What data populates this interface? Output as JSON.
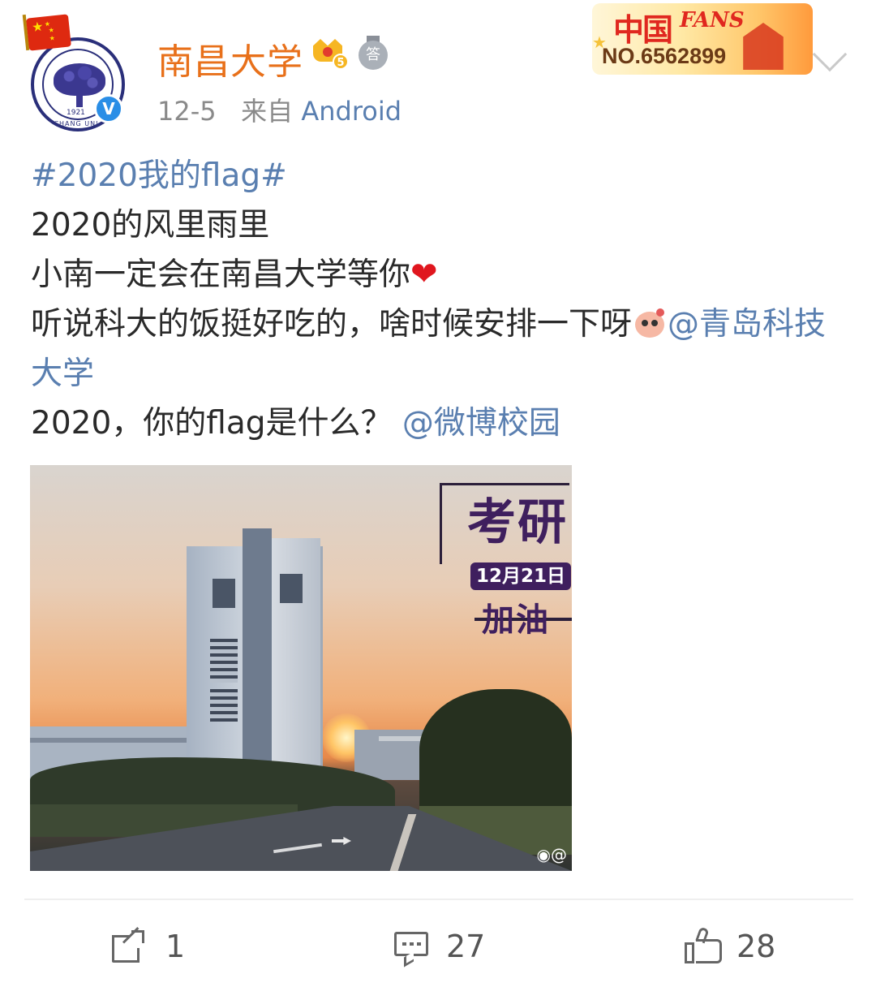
{
  "post": {
    "author": {
      "name": "南昌大学",
      "avatar_year": "1921",
      "avatar_ring_text": "NANCHANG UNI",
      "verified_mark": "V",
      "crown_level": "5",
      "medal_glyph": "答"
    },
    "meta": {
      "date": "12-5",
      "source_prefix": "来自",
      "source": "Android"
    },
    "fans_badge": {
      "text_cn": "中国",
      "text_en": "FANS",
      "number": "NO.6562899"
    },
    "content": {
      "hashtag": "#2020我的flag#",
      "line1": "2020的风里雨里",
      "line2": "小南一定会在南昌大学等你",
      "line3": "听说科大的饭挺好吃的，啥时候安排一下呀",
      "mention1": "@青岛科技大学",
      "line4": "2020，你的flag是什么？",
      "mention2": "@微博校园"
    },
    "image": {
      "title": "考研",
      "date": "12月21日",
      "cheer": "加油",
      "watermark": "@"
    },
    "actions": {
      "repost_count": "1",
      "comment_count": "27",
      "like_count": "28"
    }
  },
  "colors": {
    "username": "#e8701a",
    "link": "#5a7fb0",
    "meta": "#8a8a8a",
    "verified": "#2a8ee6",
    "heart": "#e0161e",
    "exam_purple": "#3f1f5e"
  }
}
